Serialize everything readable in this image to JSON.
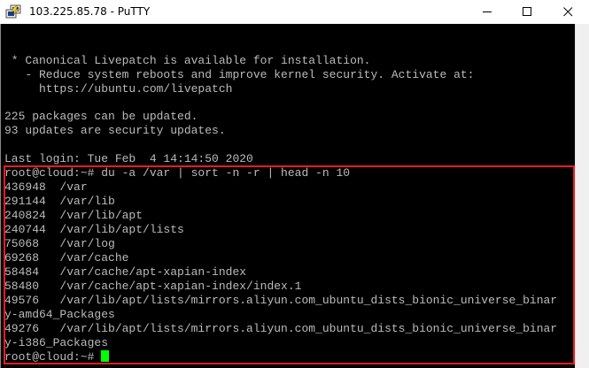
{
  "window": {
    "title": "103.225.85.78 - PuTTY",
    "app_icon": "putty-icon",
    "controls": [
      "minimize-icon",
      "maximize-icon",
      "close-icon"
    ]
  },
  "terminal": {
    "lines": [
      " * Canonical Livepatch is available for installation.",
      "   - Reduce system reboots and improve kernel security. Activate at:",
      "     https://ubuntu.com/livepatch",
      "",
      "225 packages can be updated.",
      "93 updates are security updates.",
      "",
      "Last login: Tue Feb  4 14:14:50 2020",
      "root@cloud:~# du -a /var | sort -n -r | head -n 10",
      "436948  /var",
      "291144  /var/lib",
      "240824  /var/lib/apt",
      "240744  /var/lib/apt/lists",
      "75068   /var/log",
      "69268   /var/cache",
      "58484   /var/cache/apt-xapian-index",
      "58480   /var/cache/apt-xapian-index/index.1",
      "49576   /var/lib/apt/lists/mirrors.aliyun.com_ubuntu_dists_bionic_universe_binar",
      "y-amd64_Packages",
      "49276   /var/lib/apt/lists/mirrors.aliyun.com_ubuntu_dists_bionic_universe_binar",
      "y-i386_Packages"
    ],
    "prompt": "root@cloud:~# ",
    "colors": {
      "background": "#000000",
      "text": "#bbbbbb",
      "cursor": "#00ff00",
      "highlight": "#e81b23"
    }
  }
}
